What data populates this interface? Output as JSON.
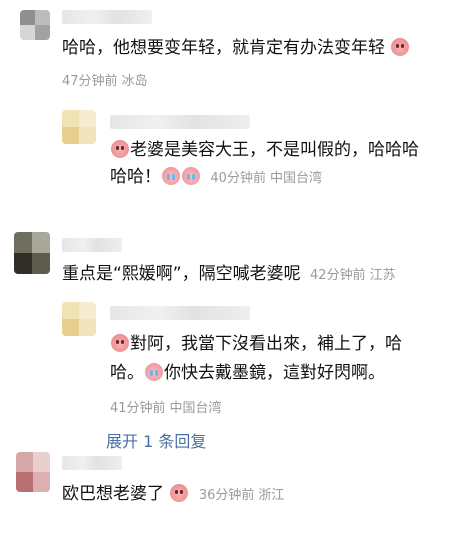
{
  "comments": [
    {
      "text": "哈哈，他想要变年轻，就肯定有办法变年轻",
      "time": "47分钟前",
      "location": "冰岛",
      "replies": [
        {
          "line1": "老婆是美容大王，不是叫假的，哈哈哈",
          "line2_text": "哈哈！",
          "time": "40分钟前",
          "location": "中国台湾"
        }
      ]
    },
    {
      "text": "重点是“熙媛啊”，隔空喊老婆呢",
      "time": "42分钟前",
      "location": "江苏",
      "replies": [
        {
          "line1": "對阿，我當下沒看出來，補上了，哈",
          "line2_a": "哈。",
          "line2_b": "你快去戴墨鏡，這對好閃啊。",
          "time": "41分钟前",
          "location": "中国台湾"
        }
      ],
      "expand_label": "展开 1 条回复"
    },
    {
      "text": "欧巴想老婆了",
      "time": "36分钟前",
      "location": "浙江"
    }
  ],
  "icons": {
    "smile_emoji": "pink-smile-emoji",
    "cry_emoji": "pink-cry-laugh-emoji"
  },
  "colors": {
    "meta": "#9a9a9a",
    "link": "#4a6fa5"
  }
}
